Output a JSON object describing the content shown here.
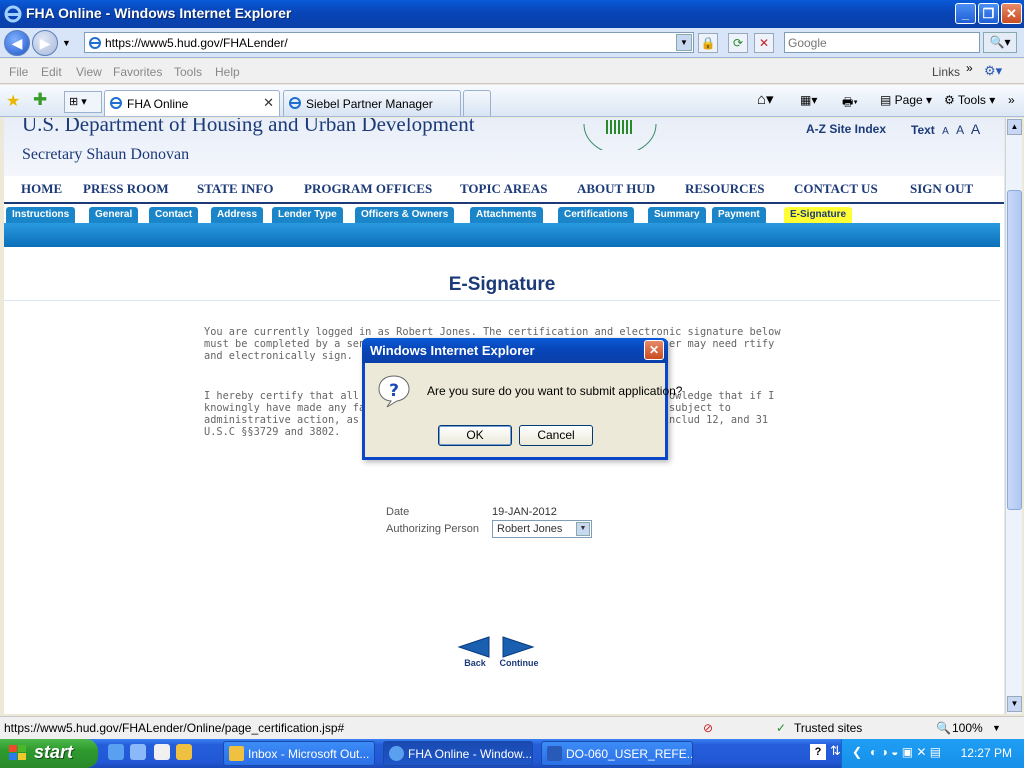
{
  "window": {
    "title": "FHA Online - Windows Internet Explorer"
  },
  "address": {
    "url": "https://www5.hud.gov/FHALender/",
    "search_placeholder": "Google"
  },
  "menu": [
    "File",
    "Edit",
    "View",
    "Favorites",
    "Tools",
    "Help"
  ],
  "links_label": "Links",
  "tabs": [
    {
      "label": "FHA Online",
      "active": true
    },
    {
      "label": "Siebel Partner Manager",
      "active": false
    }
  ],
  "commands": {
    "page": "Page",
    "tools": "Tools"
  },
  "site": {
    "department": "U.S. Department of Housing and Urban Development",
    "secretary": "Secretary Shaun Donovan",
    "az_index": "A-Z Site Index",
    "text_label": "Text",
    "text_sizes": [
      "A",
      "A",
      "A"
    ]
  },
  "mainnav": [
    "HOME",
    "PRESS ROOM",
    "STATE INFO",
    "PROGRAM OFFICES",
    "TOPIC AREAS",
    "ABOUT HUD",
    "RESOURCES",
    "CONTACT US",
    "SIGN OUT"
  ],
  "subtabs": [
    "Instructions",
    "General",
    "Contact",
    "Address",
    "Lender Type",
    "Officers & Owners",
    "Attachments",
    "Certifications",
    "Summary",
    "Payment",
    "E-Signature"
  ],
  "selected_subtab": "E-Signature",
  "page": {
    "title": "E-Signature",
    "p1": "You are currently logged in as Robert Jones. The certification and electronic signature below must be completed by a senior officer                                  of this application. The senior officer may need                                          rtify and electronically sign.",
    "p2": "I hereby certify that all of th                                                accompanying documentation is true and a                                         knowledge that if I knowingly have made any fa                                       or certification on this form or on any accompa                                     subject to administrative action, as wel                                        imprisonment, under applicable federal law, includ                                       12, and 31 U.S.C §§3729 and 3802.",
    "date_label": "Date",
    "date_value": "19-JAN-2012",
    "auth_label": "Authorizing Person",
    "auth_value": "Robert Jones",
    "back_label": "Back",
    "continue_label": "Continue"
  },
  "dialog": {
    "title": "Windows Internet Explorer",
    "message": "Are you sure do you want to submit application?",
    "ok": "OK",
    "cancel": "Cancel"
  },
  "status": {
    "url": "https://www5.hud.gov/FHALender/Online/page_certification.jsp#",
    "zone": "Trusted sites",
    "zoom": "100%"
  },
  "taskbar": {
    "start": "start",
    "tasks": [
      "Inbox - Microsoft Out...",
      "FHA Online - Window...",
      "DO-060_USER_REFE..."
    ],
    "clock": "12:27 PM"
  }
}
